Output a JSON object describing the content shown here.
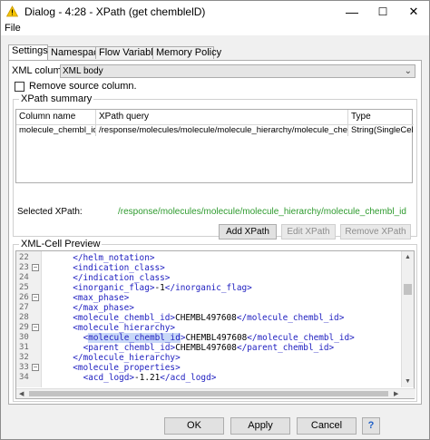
{
  "window": {
    "title": "Dialog - 4:28 - XPath (get chemblelD)",
    "minimize": "—",
    "maximize": "☐",
    "close": "✕"
  },
  "menu": {
    "file": "File"
  },
  "tabs": [
    "Settings",
    "Namespace",
    "Flow Variables",
    "Memory Policy"
  ],
  "settings": {
    "xml_column_label": "XML column:",
    "xml_column_value": "XML body",
    "remove_source_label": "Remove source column.",
    "xpath_summary_legend": "XPath summary",
    "table_headers": [
      "Column name",
      "XPath query",
      "Type"
    ],
    "table_row": [
      "molecule_chembl_id",
      "/response/molecules/molecule/molecule_hierarchy/molecule_chembl_id",
      "String(SingleCell)"
    ],
    "selected_xpath_label": "Selected XPath:",
    "selected_xpath_value": "/response/molecules/molecule/molecule_hierarchy/molecule_chembl_id",
    "add_button": "Add XPath",
    "edit_button": "Edit XPath",
    "remove_button": "Remove XPath",
    "preview_legend": "XML-Cell Preview"
  },
  "preview_lines": [
    {
      "num": "22",
      "fold": "",
      "indent": 6,
      "parts": [
        {
          "t": "</helm_notation>",
          "c": "tag"
        }
      ]
    },
    {
      "num": "23",
      "fold": "−",
      "indent": 6,
      "parts": [
        {
          "t": "<indication_class>",
          "c": "tag"
        }
      ]
    },
    {
      "num": "24",
      "fold": "",
      "indent": 6,
      "parts": [
        {
          "t": "</indication_class>",
          "c": "tag"
        }
      ]
    },
    {
      "num": "25",
      "fold": "",
      "indent": 6,
      "parts": [
        {
          "t": "<inorganic_flag>",
          "c": "tag"
        },
        {
          "t": "-1",
          "c": ""
        },
        {
          "t": "</inorganic_flag>",
          "c": "tag"
        }
      ]
    },
    {
      "num": "26",
      "fold": "−",
      "indent": 6,
      "parts": [
        {
          "t": "<max_phase>",
          "c": "tag"
        }
      ]
    },
    {
      "num": "27",
      "fold": "",
      "indent": 6,
      "parts": [
        {
          "t": "</max_phase>",
          "c": "tag"
        }
      ]
    },
    {
      "num": "28",
      "fold": "",
      "indent": 6,
      "parts": [
        {
          "t": "<molecule_chembl_id>",
          "c": "tag"
        },
        {
          "t": "CHEMBL497608",
          "c": ""
        },
        {
          "t": "</molecule_chembl_id>",
          "c": "tag"
        }
      ]
    },
    {
      "num": "29",
      "fold": "−",
      "indent": 6,
      "parts": [
        {
          "t": "<molecule_hierarchy>",
          "c": "tag"
        }
      ]
    },
    {
      "num": "30",
      "fold": "",
      "indent": 8,
      "parts": [
        {
          "t": "<",
          "c": "tag"
        },
        {
          "t": "molecule_chembl_id",
          "c": "tag hl"
        },
        {
          "t": ">",
          "c": "tag"
        },
        {
          "t": "CHEMBL497608",
          "c": ""
        },
        {
          "t": "</molecule_chembl_id>",
          "c": "tag"
        }
      ]
    },
    {
      "num": "31",
      "fold": "",
      "indent": 8,
      "parts": [
        {
          "t": "<parent_chembl_id>",
          "c": "tag"
        },
        {
          "t": "CHEMBL497608",
          "c": ""
        },
        {
          "t": "</parent_chembl_id>",
          "c": "tag"
        }
      ]
    },
    {
      "num": "32",
      "fold": "",
      "indent": 6,
      "parts": [
        {
          "t": "</molecule_hierarchy>",
          "c": "tag"
        }
      ]
    },
    {
      "num": "33",
      "fold": "−",
      "indent": 6,
      "parts": [
        {
          "t": "<molecule_properties>",
          "c": "tag"
        }
      ]
    },
    {
      "num": "34",
      "fold": "",
      "indent": 8,
      "parts": [
        {
          "t": "<acd_logd>",
          "c": "tag"
        },
        {
          "t": "-1.21",
          "c": ""
        },
        {
          "t": "</acd_logd>",
          "c": "tag"
        }
      ]
    }
  ],
  "footer": {
    "ok": "OK",
    "apply": "Apply",
    "cancel": "Cancel",
    "help": "?"
  },
  "colors": {
    "xpath_green": "#2d9a2d",
    "tag_blue": "#2020c0",
    "help_blue": "#1e5fc8"
  }
}
